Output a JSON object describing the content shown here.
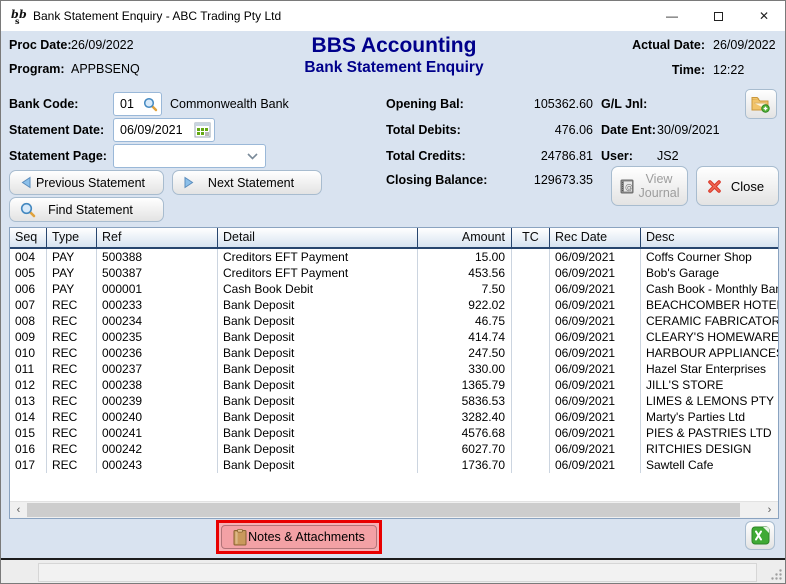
{
  "window": {
    "title": "Bank Statement Enquiry - ABC Trading Pty Ltd",
    "minimize": "—",
    "close_glyph": "✕"
  },
  "header": {
    "proc_date_label": "Proc Date:",
    "proc_date": "26/09/2022",
    "program_label": "Program:",
    "program": "APPBSENQ",
    "app_title": "BBS Accounting",
    "screen_title": "Bank Statement Enquiry",
    "actual_date_label": "Actual Date:",
    "actual_date": "26/09/2022",
    "time_label": "Time:",
    "time": "12:22"
  },
  "form": {
    "bank_code_label": "Bank Code:",
    "bank_code": "01",
    "bank_name": "Commonwealth Bank",
    "statement_date_label": "Statement Date:",
    "statement_date": "06/09/2021",
    "statement_page_label": "Statement Page:",
    "statement_page": "",
    "prev_button": "Previous Statement",
    "next_button": "Next Statement",
    "find_button": "Find Statement"
  },
  "summary": {
    "opening_bal_label": "Opening Bal:",
    "opening_bal": "105362.60",
    "total_debits_label": "Total Debits:",
    "total_debits": "476.06",
    "total_credits_label": "Total Credits:",
    "total_credits": "24786.81",
    "closing_balance_label": "Closing Balance:",
    "closing_balance": "129673.35"
  },
  "journal": {
    "gl_jnl_label": "G/L Jnl:",
    "date_ent_label": "Date Ent:",
    "date_ent": "30/09/2021",
    "user_label": "User:",
    "user": "JS2",
    "view_journal_button": "View Journal",
    "close_button": "Close"
  },
  "table": {
    "columns": [
      "Seq",
      "Type",
      "Ref",
      "Detail",
      "Amount",
      "TC",
      "Rec Date",
      "Desc"
    ],
    "rows": [
      {
        "seq": "004",
        "type": "PAY",
        "ref": "500388",
        "detail": "Creditors EFT Payment",
        "amount": "15.00",
        "tc": "",
        "rec_date": "06/09/2021",
        "desc": "Coffs Courner Shop"
      },
      {
        "seq": "005",
        "type": "PAY",
        "ref": "500387",
        "detail": "Creditors EFT Payment",
        "amount": "453.56",
        "tc": "",
        "rec_date": "06/09/2021",
        "desc": "Bob's Garage"
      },
      {
        "seq": "006",
        "type": "PAY",
        "ref": "000001",
        "detail": "Cash Book Debit",
        "amount": "7.50",
        "tc": "",
        "rec_date": "06/09/2021",
        "desc": "Cash Book - Monthly Bank"
      },
      {
        "seq": "007",
        "type": "REC",
        "ref": "000233",
        "detail": "Bank Deposit",
        "amount": "922.02",
        "tc": "",
        "rec_date": "06/09/2021",
        "desc": "BEACHCOMBER HOTEL"
      },
      {
        "seq": "008",
        "type": "REC",
        "ref": "000234",
        "detail": "Bank Deposit",
        "amount": "46.75",
        "tc": "",
        "rec_date": "06/09/2021",
        "desc": "CERAMIC FABRICATORS"
      },
      {
        "seq": "009",
        "type": "REC",
        "ref": "000235",
        "detail": "Bank Deposit",
        "amount": "414.74",
        "tc": "",
        "rec_date": "06/09/2021",
        "desc": "CLEARY'S HOMEWARES"
      },
      {
        "seq": "010",
        "type": "REC",
        "ref": "000236",
        "detail": "Bank Deposit",
        "amount": "247.50",
        "tc": "",
        "rec_date": "06/09/2021",
        "desc": "HARBOUR APPLIANCES"
      },
      {
        "seq": "011",
        "type": "REC",
        "ref": "000237",
        "detail": "Bank Deposit",
        "amount": "330.00",
        "tc": "",
        "rec_date": "06/09/2021",
        "desc": "Hazel Star Enterprises"
      },
      {
        "seq": "012",
        "type": "REC",
        "ref": "000238",
        "detail": "Bank Deposit",
        "amount": "1365.79",
        "tc": "",
        "rec_date": "06/09/2021",
        "desc": "JILL'S STORE"
      },
      {
        "seq": "013",
        "type": "REC",
        "ref": "000239",
        "detail": "Bank Deposit",
        "amount": "5836.53",
        "tc": "",
        "rec_date": "06/09/2021",
        "desc": "LIMES & LEMONS PTY LTD"
      },
      {
        "seq": "014",
        "type": "REC",
        "ref": "000240",
        "detail": "Bank Deposit",
        "amount": "3282.40",
        "tc": "",
        "rec_date": "06/09/2021",
        "desc": "Marty's Parties Ltd"
      },
      {
        "seq": "015",
        "type": "REC",
        "ref": "000241",
        "detail": "Bank Deposit",
        "amount": "4576.68",
        "tc": "",
        "rec_date": "06/09/2021",
        "desc": "PIES & PASTRIES LTD"
      },
      {
        "seq": "016",
        "type": "REC",
        "ref": "000242",
        "detail": "Bank Deposit",
        "amount": "6027.70",
        "tc": "",
        "rec_date": "06/09/2021",
        "desc": "RITCHIES DESIGN"
      },
      {
        "seq": "017",
        "type": "REC",
        "ref": "000243",
        "detail": "Bank Deposit",
        "amount": "1736.70",
        "tc": "",
        "rec_date": "06/09/2021",
        "desc": "Sawtell Cafe"
      }
    ]
  },
  "footer": {
    "notes_button": "Notes & Attachments"
  },
  "colors": {
    "client_background": "#d9e3f0",
    "title_navy": "#00008b",
    "annotation_red": "#e80000",
    "notes_pink": "#f3a1a5",
    "excel_green": "#3faa35",
    "table_header_border": "#27456e"
  }
}
